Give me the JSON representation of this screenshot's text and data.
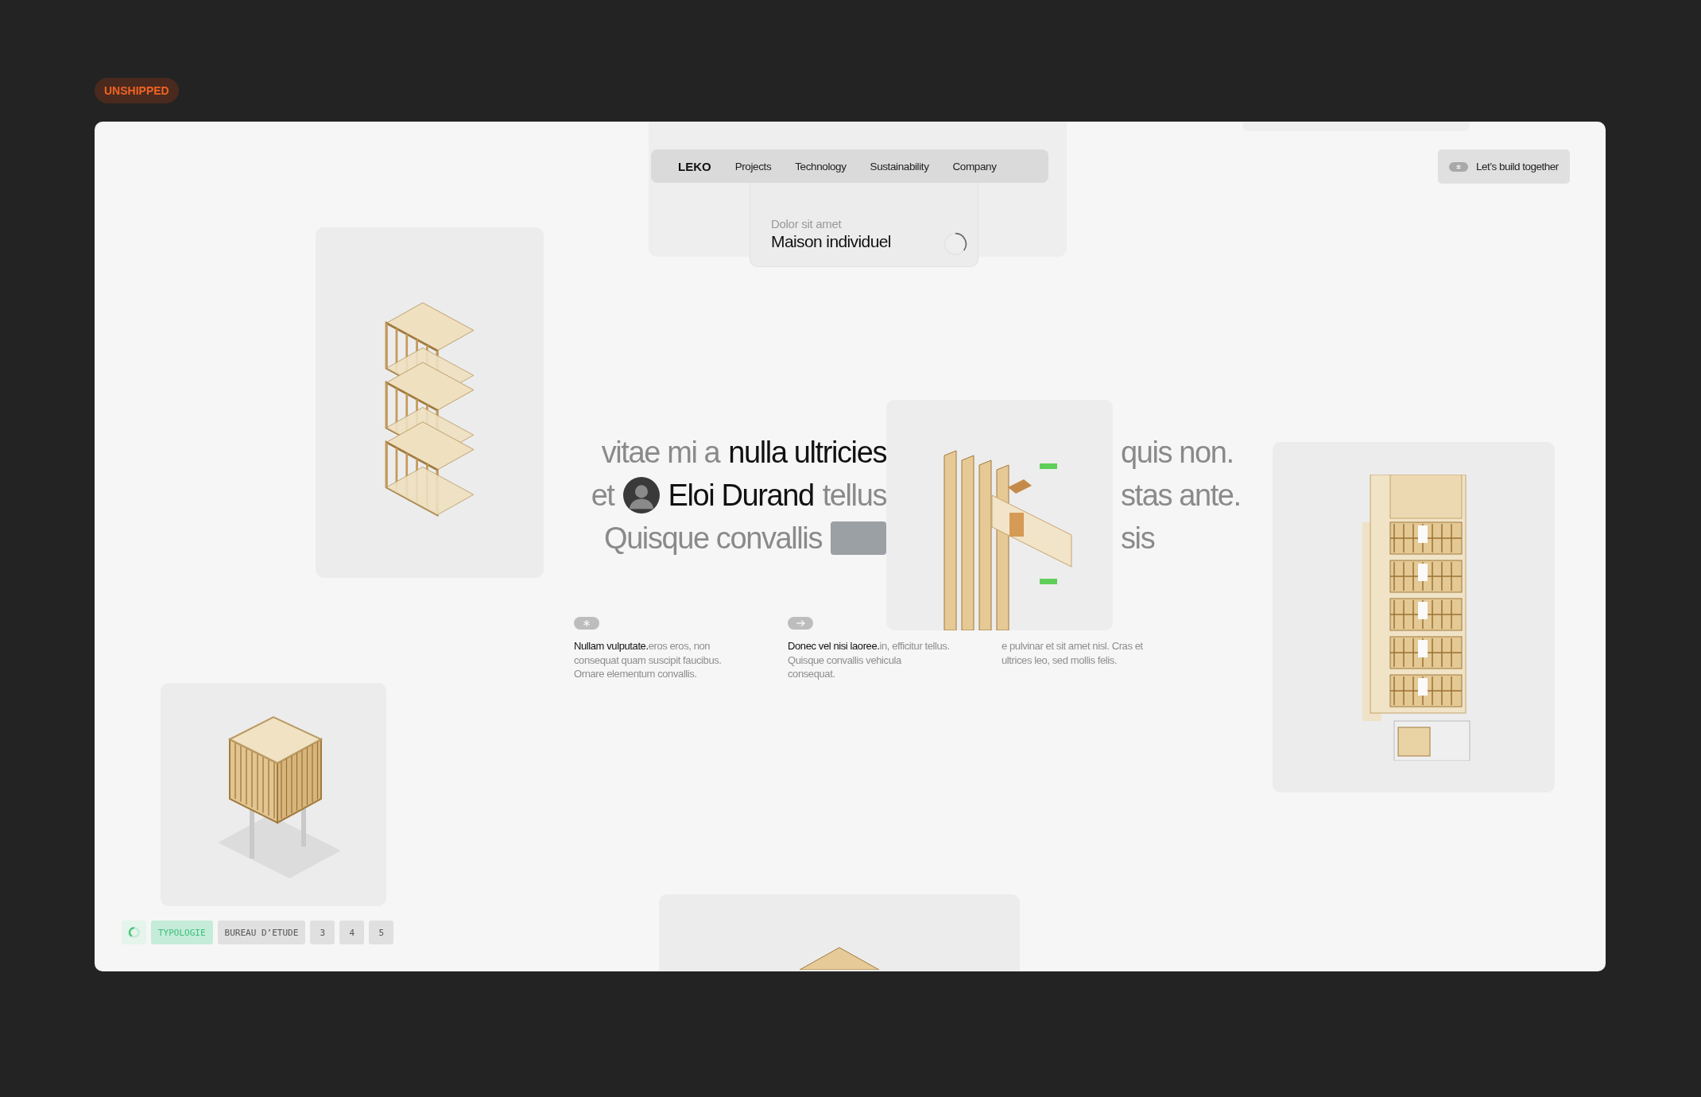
{
  "badge": "UNSHIPPED",
  "nav": {
    "brand": "LEKO",
    "links": [
      "Projects",
      "Technology",
      "Sustainability",
      "Company"
    ]
  },
  "feature_card": {
    "subtitle": "Dolor sit amet",
    "title": "Maison individuel"
  },
  "cta": {
    "label": "Let’s build together"
  },
  "hero": {
    "lines": [
      {
        "left": [
          {
            "kind": "text",
            "text": "vitae mi a"
          },
          {
            "kind": "strong",
            "text": "nulla ultricies"
          }
        ],
        "right": "quis non."
      },
      {
        "left": [
          {
            "kind": "text",
            "text": "et"
          },
          {
            "kind": "avatar"
          },
          {
            "kind": "strong",
            "text": "Eloi Durand"
          },
          {
            "kind": "text",
            "text": "tellus"
          }
        ],
        "right": "stas ante."
      },
      {
        "left": [
          {
            "kind": "text",
            "text": "Quisque convallis"
          },
          {
            "kind": "photo"
          }
        ],
        "right": "sis"
      }
    ]
  },
  "features": [
    {
      "kind": "asterisk",
      "lead": "Nullam vulputate.",
      "text": "eros eros, non consequat quam suscipit faucibus. Ornare elementum convallis."
    },
    {
      "kind": "arrow",
      "lead": "Donec vel nisi laoree.",
      "text": "in, efficitur tellus. Quisque convallis vehicula consequat."
    },
    {
      "kind": "plain",
      "text": "e pulvinar et sit amet nisl. Cras et ultrices leo, sed mollis felis."
    }
  ],
  "tabs": [
    {
      "label": "TYPOLOGIE",
      "selected": true
    },
    {
      "label": "BUREAU D’ETUDE",
      "selected": false
    },
    {
      "label": "3",
      "selected": false
    },
    {
      "label": "4",
      "selected": false
    },
    {
      "label": "5",
      "selected": false
    }
  ]
}
